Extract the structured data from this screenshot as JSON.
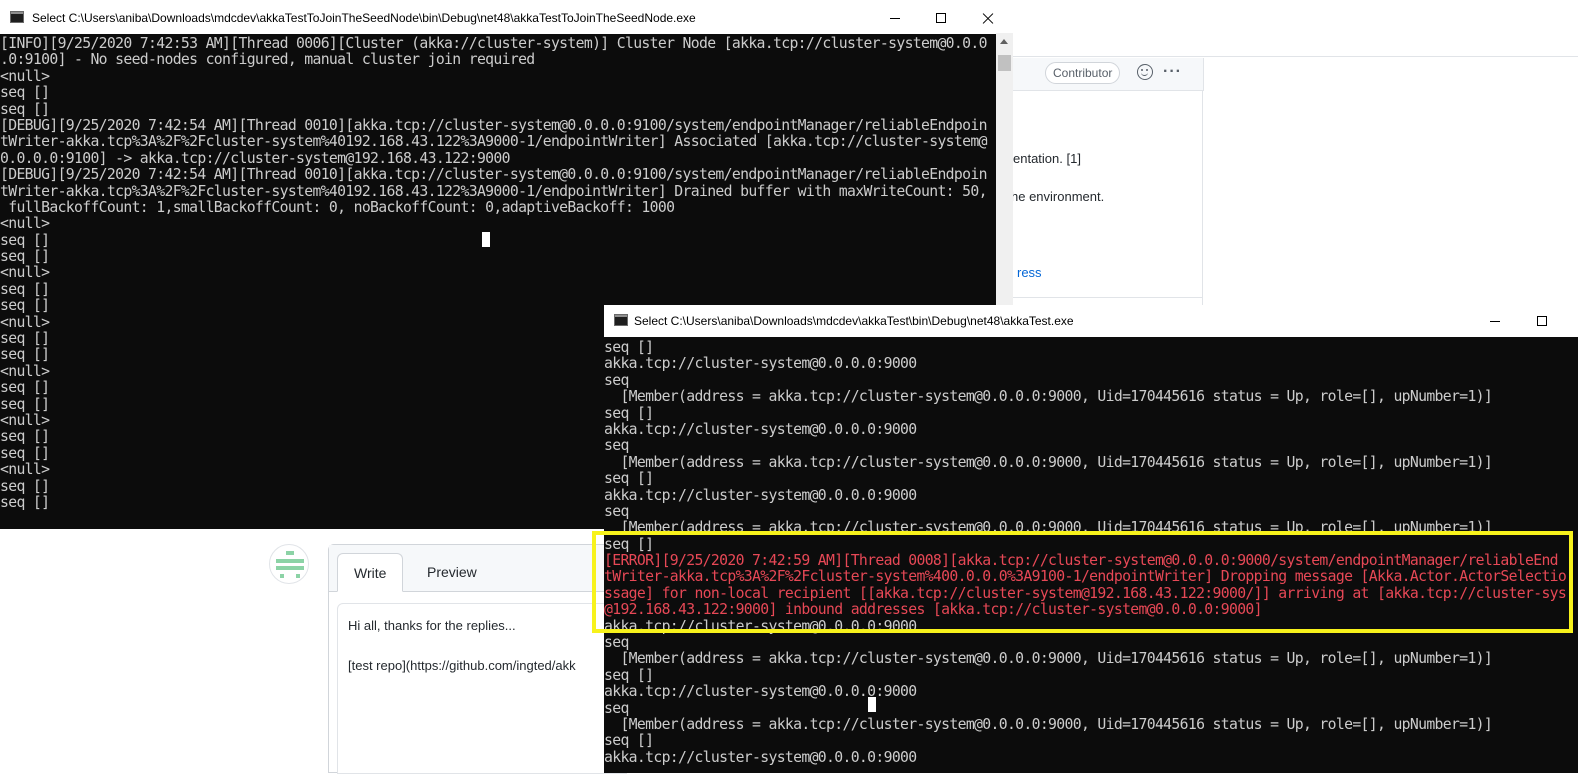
{
  "github": {
    "contributor_badge": "Contributor",
    "body_fragment_1": "entation. [1]",
    "body_fragment_2": "he environment.",
    "link_fragment": "ress",
    "editor": {
      "tab_write": "Write",
      "tab_preview": "Preview",
      "text": "Hi all, thanks for the replies...\n\n[test repo](https://github.com/ingted/akk"
    },
    "icons": [
      "emoji-icon",
      "more-options-icon",
      "avatar"
    ]
  },
  "window_left": {
    "title": "Select C:\\Users\\aniba\\Downloads\\mdcdev\\akkaTestToJoinTheSeedNode\\bin\\Debug\\net48\\akkaTestToJoinTheSeedNode.exe",
    "lines": [
      "[INFO][9/25/2020 7:42:53 AM][Thread 0006][Cluster (akka://cluster-system)] Cluster Node [akka.tcp://cluster-system@0.0.0",
      ".0:9100] - No seed-nodes configured, manual cluster join required",
      "<null>",
      "seq []",
      "seq []",
      "[DEBUG][9/25/2020 7:42:54 AM][Thread 0010][akka.tcp://cluster-system@0.0.0.0:9100/system/endpointManager/reliableEndpoin",
      "tWriter-akka.tcp%3A%2F%2Fcluster-system%40192.168.43.122%3A9000-1/endpointWriter] Associated [akka.tcp://cluster-system@",
      "0.0.0.0:9100] -> akka.tcp://cluster-system@192.168.43.122:9000",
      "[DEBUG][9/25/2020 7:42:54 AM][Thread 0010][akka.tcp://cluster-system@0.0.0.0:9100/system/endpointManager/reliableEndpoin",
      "tWriter-akka.tcp%3A%2F%2Fcluster-system%40192.168.43.122%3A9000-1/endpointWriter] Drained buffer with maxWriteCount: 50,",
      " fullBackoffCount: 1,smallBackoffCount: 0, noBackoffCount: 0,adaptiveBackoff: 1000",
      "<null>",
      "seq []",
      "seq []",
      "<null>",
      "seq []",
      "seq []",
      "<null>",
      "seq []",
      "seq []",
      "<null>",
      "seq []",
      "seq []",
      "<null>",
      "seq []",
      "seq []",
      "<null>",
      "seq []",
      "seq []"
    ]
  },
  "window_right": {
    "title": "Select C:\\Users\\aniba\\Downloads\\mdcdev\\akkaTest\\bin\\Debug\\net48\\akkaTest.exe",
    "lines": [
      {
        "t": "seq []",
        "err": false
      },
      {
        "t": "akka.tcp://cluster-system@0.0.0.0:9000",
        "err": false
      },
      {
        "t": "seq",
        "err": false
      },
      {
        "t": "  [Member(address = akka.tcp://cluster-system@0.0.0.0:9000, Uid=170445616 status = Up, role=[], upNumber=1)]",
        "err": false
      },
      {
        "t": "seq []",
        "err": false
      },
      {
        "t": "akka.tcp://cluster-system@0.0.0.0:9000",
        "err": false
      },
      {
        "t": "seq",
        "err": false
      },
      {
        "t": "  [Member(address = akka.tcp://cluster-system@0.0.0.0:9000, Uid=170445616 status = Up, role=[], upNumber=1)]",
        "err": false
      },
      {
        "t": "seq []",
        "err": false
      },
      {
        "t": "akka.tcp://cluster-system@0.0.0.0:9000",
        "err": false
      },
      {
        "t": "seq",
        "err": false
      },
      {
        "t": "  [Member(address = akka.tcp://cluster-system@0.0.0.0:9000, Uid=170445616 status = Up, role=[], upNumber=1)]",
        "err": false
      },
      {
        "t": "seq []",
        "err": false
      },
      {
        "t": "[ERROR][9/25/2020 7:42:59 AM][Thread 0008][akka.tcp://cluster-system@0.0.0.0:9000/system/endpointManager/reliableEnd",
        "err": true
      },
      {
        "t": "tWriter-akka.tcp%3A%2F%2Fcluster-system%400.0.0.0%3A9100-1/endpointWriter] Dropping message [Akka.Actor.ActorSelectio",
        "err": true
      },
      {
        "t": "ssage] for non-local recipient [[akka.tcp://cluster-system@192.168.43.122:9000/]] arriving at [akka.tcp://cluster-sys",
        "err": true
      },
      {
        "t": "@192.168.43.122:9000] inbound addresses [akka.tcp://cluster-system@0.0.0.0:9000]",
        "err": true
      },
      {
        "t": "akka.tcp://cluster-system@0.0.0.0:9000",
        "err": false
      },
      {
        "t": "seq",
        "err": false
      },
      {
        "t": "  [Member(address = akka.tcp://cluster-system@0.0.0.0:9000, Uid=170445616 status = Up, role=[], upNumber=1)]",
        "err": false
      },
      {
        "t": "seq []",
        "err": false
      },
      {
        "t": "akka.tcp://cluster-system@0.0.0.0:9000",
        "err": false
      },
      {
        "t": "seq",
        "err": false
      },
      {
        "t": "  [Member(address = akka.tcp://cluster-system@0.0.0.0:9000, Uid=170445616 status = Up, role=[], upNumber=1)]",
        "err": false
      },
      {
        "t": "seq []",
        "err": false
      },
      {
        "t": "akka.tcp://cluster-system@0.0.0.0:9000",
        "err": false
      }
    ]
  },
  "colors": {
    "console_bg": "#0c0c0c",
    "console_text": "#cccccc",
    "error_text": "#e74856",
    "highlight": "#f7f21b"
  }
}
